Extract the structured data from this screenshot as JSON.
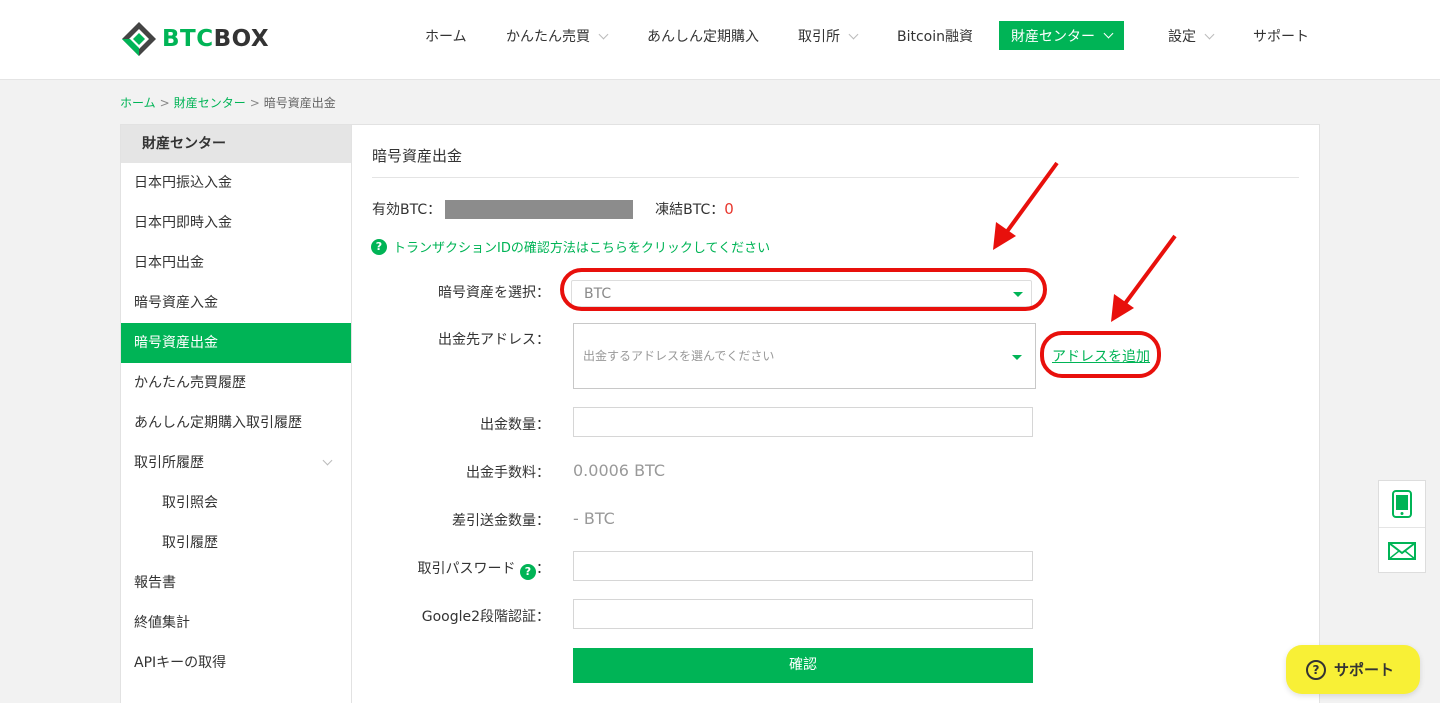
{
  "header": {
    "logo": {
      "btc": "BTC",
      "box": "BOX"
    },
    "nav": [
      {
        "label": "ホーム",
        "dropdown": false
      },
      {
        "label": "かんたん売買",
        "dropdown": true
      },
      {
        "label": "あんしん定期購入",
        "dropdown": false
      },
      {
        "label": "取引所",
        "dropdown": true
      },
      {
        "label": "Bitcoin融資",
        "dropdown": false
      },
      {
        "label": "財産センター",
        "dropdown": true,
        "active": true
      },
      {
        "label": "設定",
        "dropdown": true
      },
      {
        "label": "サポート",
        "dropdown": false
      }
    ]
  },
  "breadcrumb": {
    "home": "ホーム",
    "center": "財産センター",
    "current": "暗号資産出金",
    "sep": ">"
  },
  "sidebar": {
    "title": "財産センター",
    "items": [
      {
        "label": "日本円振込入金"
      },
      {
        "label": "日本円即時入金"
      },
      {
        "label": "日本円出金"
      },
      {
        "label": "暗号資産入金"
      },
      {
        "label": "暗号資産出金",
        "active": true
      },
      {
        "label": "かんたん売買履歴"
      },
      {
        "label": "あんしん定期購入取引履歴"
      },
      {
        "label": "取引所履歴",
        "expandable": true
      },
      {
        "label": "取引照会",
        "sub": true
      },
      {
        "label": "取引履歴",
        "sub": true
      },
      {
        "label": "報告書"
      },
      {
        "label": "終値集計"
      },
      {
        "label": "APIキーの取得"
      }
    ]
  },
  "main": {
    "title": "暗号資産出金",
    "available_label": "有効BTC：",
    "frozen_label": "凍結BTC：",
    "frozen_value": "0",
    "help_link": "トランザクションIDの確認方法はこちらをクリックしてください",
    "form": {
      "asset_label": "暗号資産を選択：",
      "asset_value": "BTC",
      "address_label": "出金先アドレス：",
      "address_placeholder": "出金するアドレスを選んでください",
      "add_address": "アドレスを追加",
      "amount_label": "出金数量：",
      "fee_label": "出金手数料：",
      "fee_value": "0.0006 BTC",
      "net_label": "差引送金数量：",
      "net_value": "- BTC",
      "password_label": "取引パスワード",
      "password_colon": "：",
      "twofa_label": "Google2段階認証：",
      "confirm": "確認"
    }
  },
  "support_button": "サポート",
  "colors": {
    "brand": "#00b456",
    "annotation": "#e8100c",
    "support_bg": "#f8f036"
  },
  "icons": [
    "logo-icon",
    "question-icon",
    "phone-icon",
    "mail-icon",
    "dropdown-triangle-icon",
    "chevron-down-icon"
  ]
}
